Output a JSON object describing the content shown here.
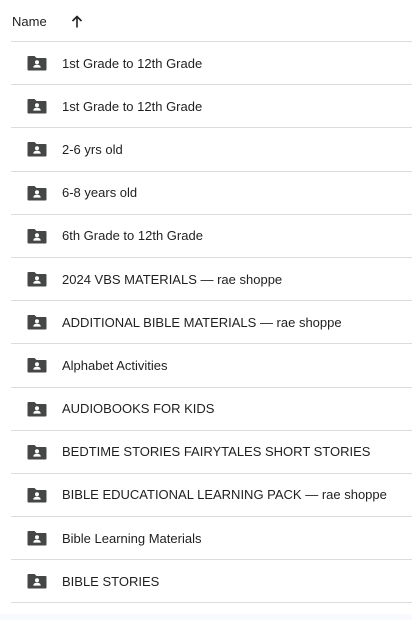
{
  "header": {
    "name_label": "Name",
    "sort_icon": "arrow-upward-icon"
  },
  "rows": [
    {
      "label": "1st Grade to 12th Grade",
      "icon": "shared-folder-icon"
    },
    {
      "label": "1st Grade to 12th Grade",
      "icon": "shared-folder-icon"
    },
    {
      "label": "2-6 yrs old",
      "icon": "shared-folder-icon"
    },
    {
      "label": "6-8 years old",
      "icon": "shared-folder-icon"
    },
    {
      "label": "6th Grade to 12th Grade",
      "icon": "shared-folder-icon"
    },
    {
      "label": "2024 VBS MATERIALS — rae shoppe",
      "icon": "shared-folder-icon"
    },
    {
      "label": "ADDITIONAL BIBLE MATERIALS — rae shoppe",
      "icon": "shared-folder-icon"
    },
    {
      "label": "Alphabet Activities",
      "icon": "shared-folder-icon"
    },
    {
      "label": "AUDIOBOOKS FOR KIDS",
      "icon": "shared-folder-icon"
    },
    {
      "label": "BEDTIME STORIES FAIRYTALES SHORT STORIES",
      "icon": "shared-folder-icon"
    },
    {
      "label": "BIBLE EDUCATIONAL LEARNING PACK — rae shoppe",
      "icon": "shared-folder-icon"
    },
    {
      "label": "Bible Learning Materials",
      "icon": "shared-folder-icon"
    },
    {
      "label": "BIBLE STORIES",
      "icon": "shared-folder-icon"
    }
  ],
  "colors": {
    "icon": "#444746",
    "text": "#1f1f1f",
    "divider": "#dadce0"
  }
}
